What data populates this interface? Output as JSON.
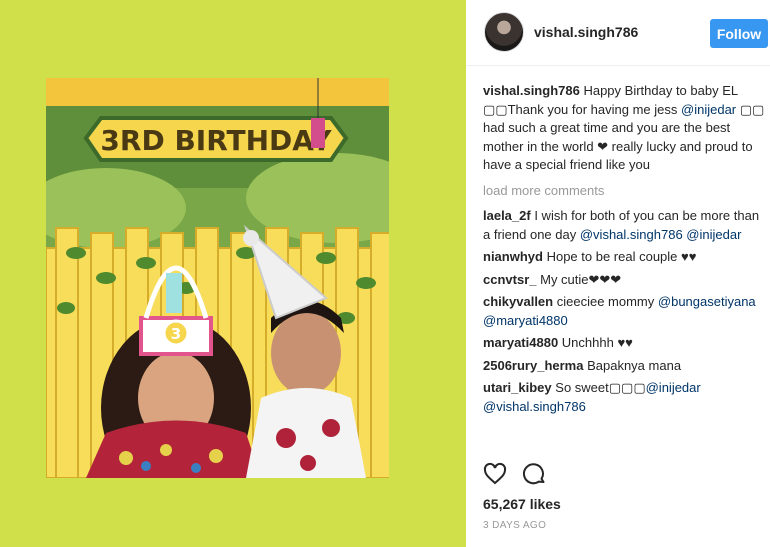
{
  "post": {
    "author": "vishal.singh786",
    "follow_label": "Follow"
  },
  "caption": {
    "user": "vishal.singh786",
    "text_1": "Happy Birthday to baby EL",
    "emoji_1": "▢▢",
    "text_2": "Thank you for having me jess",
    "mention": "@inijedar",
    "emoji_2": "▢▢",
    "text_3": "had such a great time and you are the best mother in the world ❤ really lucky and proud to have a special friend like you"
  },
  "load_more_label": "load more comments",
  "comments": [
    {
      "user": "laela_2f",
      "text": "I wish for both of you can be more than a friend one day",
      "mentions": "@vishal.singh786 @inijedar"
    },
    {
      "user": "nianwhyd",
      "text": "Hope to be real couple ♥♥",
      "mentions": ""
    },
    {
      "user": "ccnvtsr_",
      "text": "My cutie❤❤❤",
      "mentions": ""
    },
    {
      "user": "chikyvallen",
      "text": "cieeciee mommy",
      "mentions": "@bungasetiyana @maryati4880"
    },
    {
      "user": "maryati4880",
      "text": "Unchhhh ♥♥",
      "mentions": ""
    },
    {
      "user": "2506rury_herma",
      "text": "Bapaknya mana",
      "mentions": ""
    },
    {
      "user": "utari_kibey",
      "text": "So sweet▢▢▢",
      "mentions": "@inijedar @vishal.singh786"
    }
  ],
  "likes": "65,267 likes",
  "date": "3 DAYS AGO",
  "photo": {
    "banner_text": "3RD BIRTHDAY",
    "hat_number": "3"
  },
  "colors": {
    "background": "#cfe04a",
    "follow": "#3897f0",
    "mention": "#003569",
    "muted": "#999999"
  },
  "icons": [
    "heart-icon",
    "comment-icon"
  ]
}
